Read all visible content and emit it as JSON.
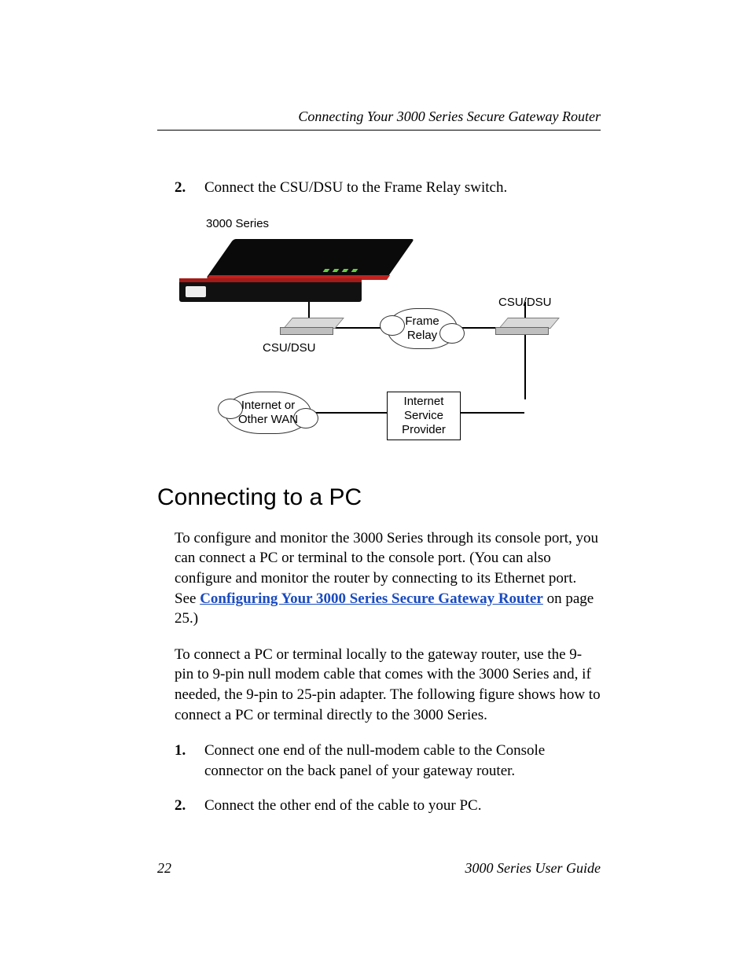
{
  "header": {
    "title": "Connecting Your 3000 Series Secure Gateway Router"
  },
  "step_top": {
    "num": "2.",
    "text": "Connect the CSU/DSU to the Frame Relay switch."
  },
  "figure": {
    "device_label": "3000 Series",
    "csu_left": "CSU/DSU",
    "csu_right": "CSU/DSU",
    "cloud_frame": "Frame\nRelay",
    "cloud_wan": "Internet or\nOther WAN",
    "isp": "Internet\nService\nProvider"
  },
  "section": {
    "heading": "Connecting to a PC",
    "para1_a": "To configure and monitor the 3000 Series through its console port, you can connect a PC or terminal to the console port. (You can also configure and monitor the router by connecting to its Ethernet port. See ",
    "link": "Configuring Your 3000 Series Secure Gateway Router",
    "para1_b": " on page 25.)",
    "para2": "To connect a PC or terminal locally to the gateway router, use the 9-pin to 9-pin null modem cable that comes with the 3000 Series and, if needed, the 9-pin to 25-pin adapter. The following figure shows how to connect a PC or terminal directly to the 3000 Series.",
    "steps": [
      {
        "num": "1.",
        "text": "Connect one end of the null-modem cable to the Console connector on the back panel of your gateway router."
      },
      {
        "num": "2.",
        "text": "Connect the other end of the cable to your PC."
      }
    ]
  },
  "footer": {
    "page": "22",
    "doc": "3000 Series User Guide"
  }
}
